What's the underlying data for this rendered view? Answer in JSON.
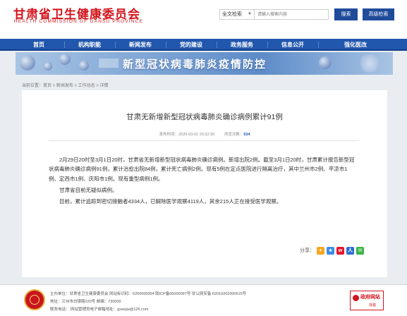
{
  "header": {
    "logo_cn": "甘肃省卫生健康委员会",
    "logo_en": "HEALTH  COMMISSION  OF  GANSU  PROVINCE",
    "search_scope": "全文检索",
    "search_placeholder": "请输入搜索内容",
    "search_button": "搜索",
    "advanced_button": "高级检索"
  },
  "nav": {
    "items": [
      {
        "label": "首页"
      },
      {
        "label": "机构职能"
      },
      {
        "label": "新闻发布"
      },
      {
        "label": "党的建设"
      },
      {
        "label": "政务服务"
      },
      {
        "label": "信息公开"
      },
      {
        "label": "强化医改"
      }
    ]
  },
  "banner": {
    "text": "新型冠状病毒肺炎疫情防控"
  },
  "breadcrumb": "当前位置：首页 > 新闻发布 > 工作动态 > 详情",
  "article": {
    "title": "甘肃无新增新型冠状病毒肺炎确诊病例累计91例",
    "publish_time": "发布时间：2020-03-01 20:32:30",
    "hits_label": "浏览次数：",
    "hits": "534",
    "paragraphs": [
      "2月29日20时至3月1日20时，甘肃省无新增新型冠状病毒肺炎确诊病例。新增出院2例。截至3月1日20时，甘肃累计报告新型冠状病毒肺炎确诊病例91例，累计治愈出院84例，累计死亡病例2例。现有5例在定点医院进行隔离治疗，其中兰州市2例、平凉市1例、定西市1例、庆阳市1例。现有重型病例1例。",
      "甘肃省目前无疑似病例。",
      "目前，累计追踪到密切接触者4334人，已解除医学观察4119人，其余215人正在接受医学观察。"
    ]
  },
  "share": {
    "label": "分享："
  },
  "footer": {
    "line1": "主办单位：甘肃省卫生健康委员会    网站标识码：6200000054    陇ICP备05000097号    甘公网安备 62010202000515号",
    "line2": "地址：兰州市白银路220号    邮编：730000",
    "line3": "联系电话：    网站管理员电子邮箱地址：gswsjw@126.com",
    "badge_text": "政府网站",
    "badge_sub": "找错"
  },
  "colors": {
    "brand_red": "#d2141b",
    "nav_blue": "#2157ad",
    "button_blue": "#1f4b9b"
  }
}
